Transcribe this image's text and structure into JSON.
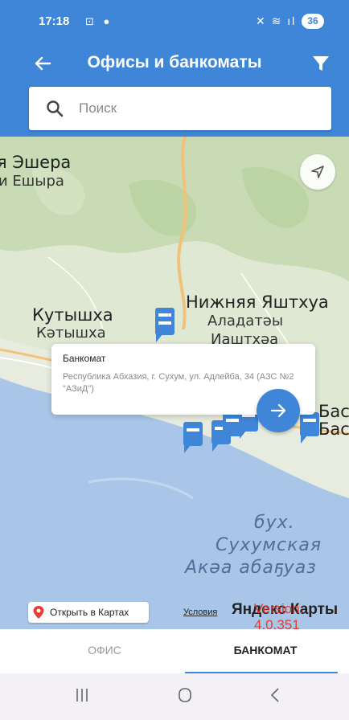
{
  "status_bar": {
    "time": "17:18",
    "left_icons": "⊡ ●",
    "right_icons": "✕ ≋ ıl ıl",
    "battery": "36"
  },
  "app_bar": {
    "title": "Офисы и банкоматы",
    "back_icon": "arrow-left-icon",
    "filter_icon": "filter-icon"
  },
  "search": {
    "placeholder": "Поиск",
    "value": ""
  },
  "map": {
    "labels": {
      "esher_ru": "я Эшера",
      "esher_ab": "и Ешыра",
      "kutyshkha_ru": "Кутышха",
      "kutyshkha_ab": "Кәтышха",
      "yashtkhva_ru": "Нижняя Яштхуа",
      "yashtkhva_ab1": "Аладатәы",
      "yashtkhva_ab2": "Иаштхәа",
      "bas1": "Бас",
      "bas2": "Бас",
      "bay_1": "бух.",
      "bay_2": "Сухумская",
      "bay_3": "Акәа абаҕуаз"
    },
    "popup": {
      "title": "Банкомат",
      "address": "Республика Абхазия, г. Сухум, ул. Адлейба, 34 (АЗС №2 \"АЗиД\")"
    },
    "open_in_maps": "Открыть в Картах",
    "terms": "Условия",
    "brand": "Яндекс Карты",
    "version": "Version: 4.0.351",
    "colors": {
      "water": "#a9c6e8",
      "land": "#dfe8d3",
      "forest": "#c9dbb5",
      "road": "#f0c27a",
      "pin": "#3f86d8"
    }
  },
  "tabs": {
    "office": "ОФИС",
    "atm": "БАНКОМАТ",
    "active": "atm"
  },
  "nav_bar": {
    "recent": "|||",
    "home": "○",
    "back": "<"
  },
  "accent": "#3f86d8"
}
